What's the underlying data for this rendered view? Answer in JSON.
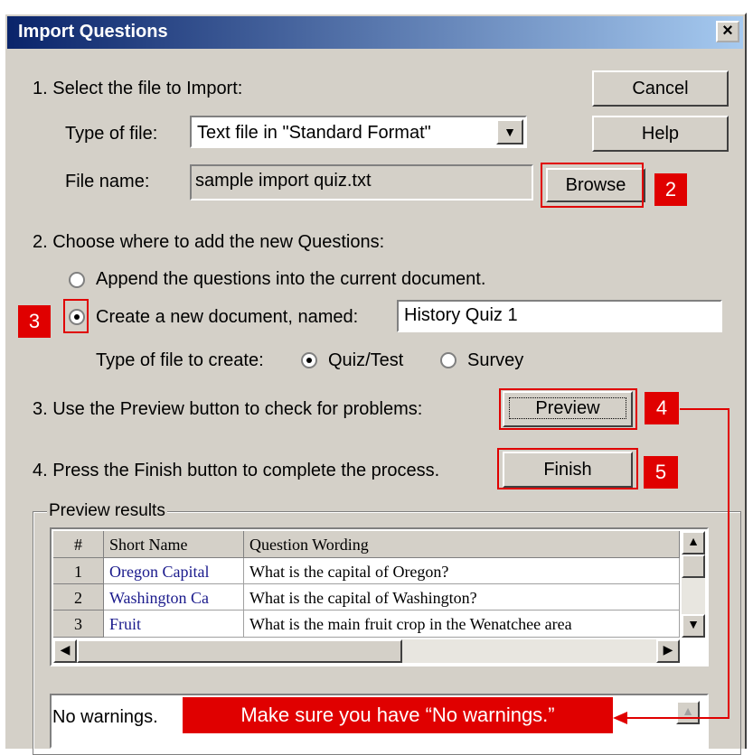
{
  "dialog": {
    "title": "Import Questions",
    "close": "×"
  },
  "step1": {
    "label": "1.  Select the file to Import:",
    "type_label": "Type of file:",
    "type_value": "Text file in \"Standard Format\"",
    "file_label": "File name:",
    "file_value": "sample import quiz.txt",
    "browse": "Browse"
  },
  "buttons": {
    "cancel": "Cancel",
    "help": "Help",
    "preview": "Preview",
    "finish": "Finish"
  },
  "step2": {
    "label": "2.  Choose where to add the new Questions:",
    "append": "Append the questions into the current document.",
    "create": "Create a new document, named:",
    "doc_name": "History Quiz 1",
    "type_label": "Type of file to create:",
    "quiz": "Quiz/Test",
    "survey": "Survey"
  },
  "step3": {
    "label": "3.  Use the Preview button to check for problems:"
  },
  "step4": {
    "label": "4.  Press the Finish button to complete the process."
  },
  "preview": {
    "group_label": "Preview results",
    "headers": [
      "#",
      "Short Name",
      "Question Wording"
    ],
    "rows": [
      [
        "1",
        "Oregon Capital",
        "What is the capital of Oregon?"
      ],
      [
        "2",
        "Washington Ca",
        "What is the capital of Washington?"
      ],
      [
        "3",
        "Fruit",
        "What is the main fruit crop in the Wenatchee area"
      ]
    ]
  },
  "warnings": "No warnings.",
  "annotations": {
    "tags": [
      "2",
      "3",
      "4",
      "5"
    ],
    "callout": "Make sure you have “No warnings.”"
  },
  "colors": {
    "annotation": "#e00000",
    "title_bar": "#0a246a",
    "link_text": "#1a1a8c"
  }
}
